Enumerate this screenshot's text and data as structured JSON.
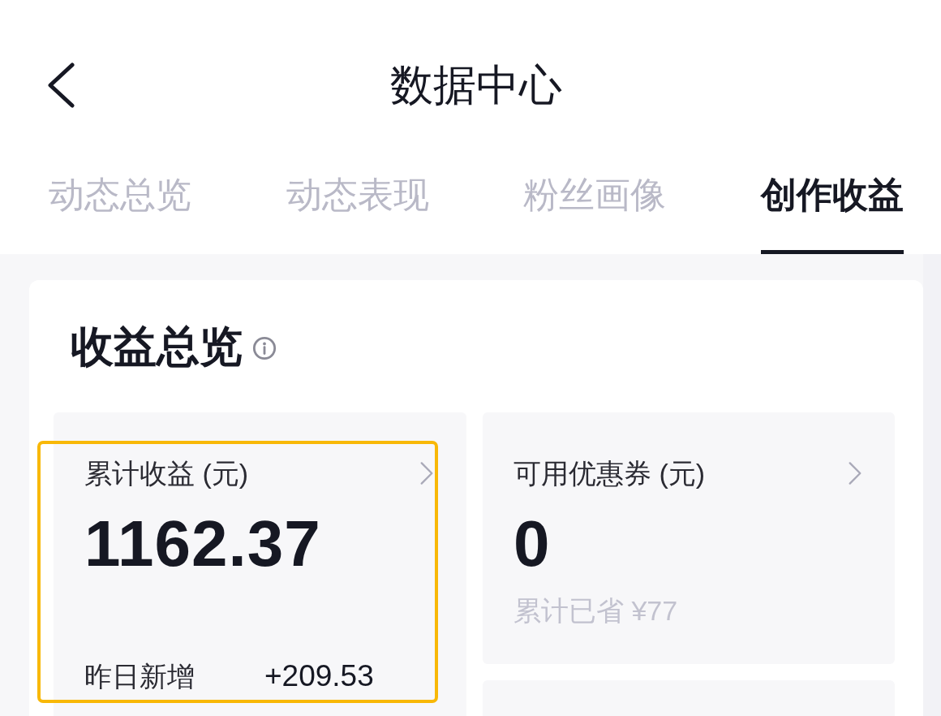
{
  "header": {
    "title": "数据中心"
  },
  "tabs": [
    {
      "label": "动态总览",
      "selected": false
    },
    {
      "label": "动态表现",
      "selected": false
    },
    {
      "label": "粉丝画像",
      "selected": false
    },
    {
      "label": "创作收益",
      "selected": true
    }
  ],
  "earnings_overview": {
    "title": "收益总览",
    "stats": [
      {
        "kind": "total",
        "label": "累计收益 (元)",
        "value": "1162.37",
        "highlighted": true,
        "footer": {
          "label": "昨日新增",
          "value": "+209.53"
        }
      },
      {
        "kind": "coupon",
        "label": "可用优惠券 (元)",
        "value": "0",
        "highlighted": false,
        "note": "累计已省 ¥77"
      }
    ]
  }
}
